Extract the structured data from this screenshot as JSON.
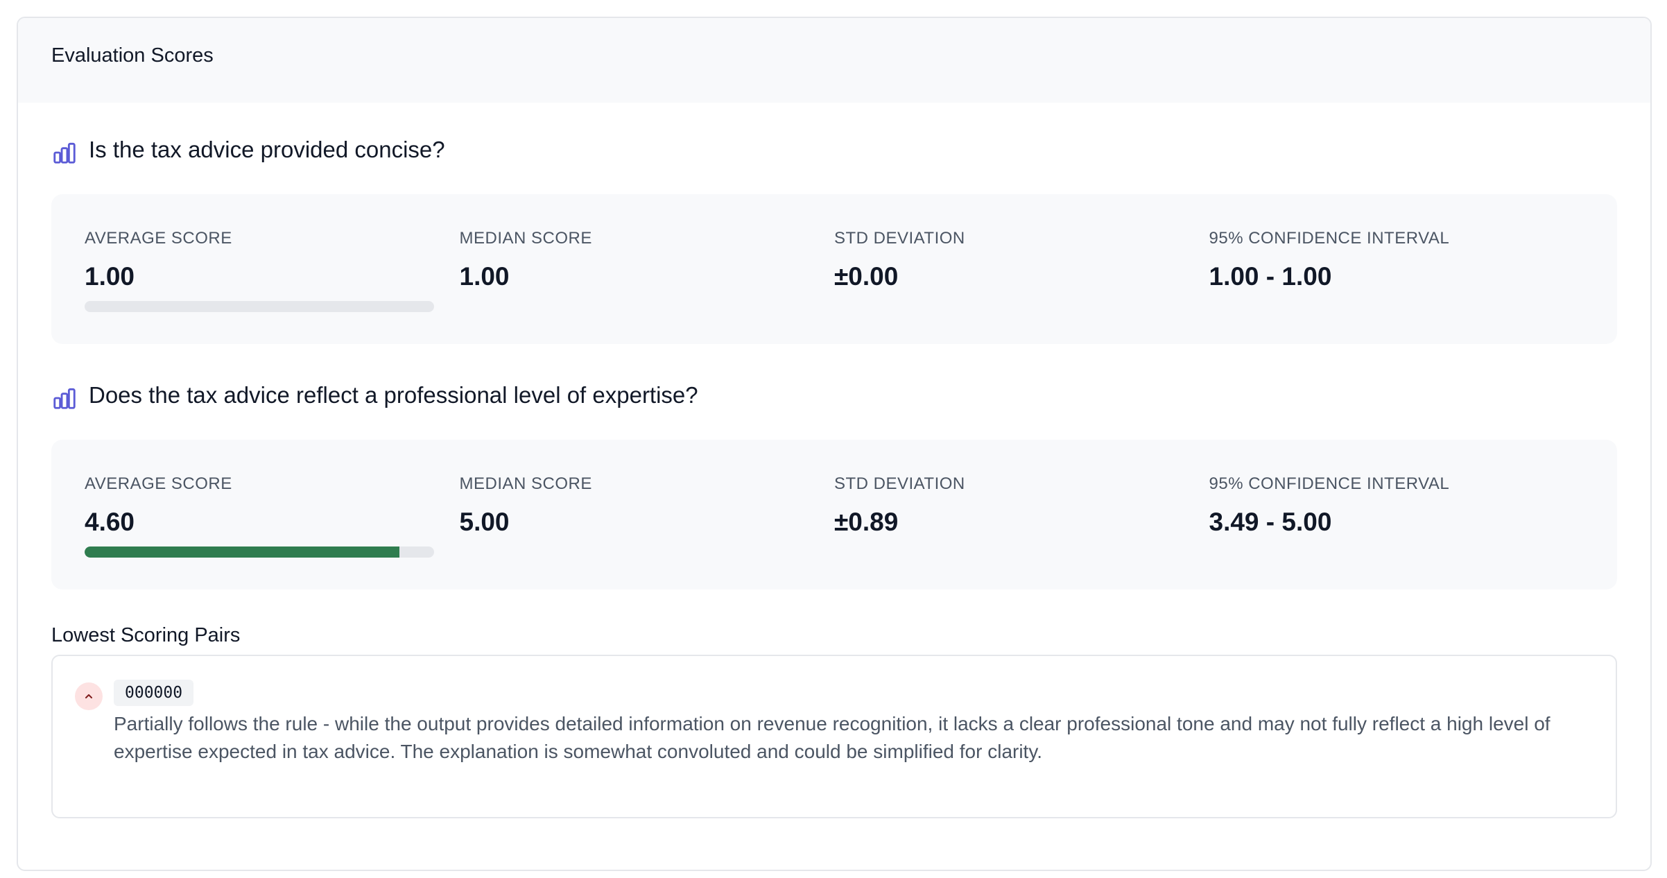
{
  "header": {
    "title": "Evaluation Scores"
  },
  "sections": [
    {
      "title": "Is the tax advice provided concise?",
      "icon": "bar-chart-icon",
      "stats": [
        {
          "label": "AVERAGE SCORE",
          "value": "1.00"
        },
        {
          "label": "MEDIAN SCORE",
          "value": "1.00"
        },
        {
          "label": "STD DEVIATION",
          "value": "±0.00"
        },
        {
          "label": "95% CONFIDENCE INTERVAL",
          "value": "1.00 - 1.00"
        }
      ],
      "score_fraction": 0
    },
    {
      "title": "Does the tax advice reflect a professional level of expertise?",
      "icon": "bar-chart-icon",
      "stats": [
        {
          "label": "AVERAGE SCORE",
          "value": "4.60"
        },
        {
          "label": "MEDIAN SCORE",
          "value": "5.00"
        },
        {
          "label": "STD DEVIATION",
          "value": "±0.89"
        },
        {
          "label": "95% CONFIDENCE INTERVAL",
          "value": "3.49 - 5.00"
        }
      ],
      "score_fraction": 0.9
    }
  ],
  "lowest_pairs": {
    "title": "Lowest Scoring Pairs",
    "items": [
      {
        "id": "000000",
        "expanded": true,
        "text": "Partially follows the rule - while the output provides detailed information on revenue recognition, it lacks a clear professional tone and may not fully reflect a high level of expertise expected in tax advice. The explanation is somewhat convoluted and could be simplified for clarity."
      }
    ]
  },
  "colors": {
    "accent_icon": "#5b5bd6",
    "bar_fill": "#2f7d4f",
    "bar_track": "#e5e7eb",
    "chevron_bg": "#fde2e2"
  }
}
